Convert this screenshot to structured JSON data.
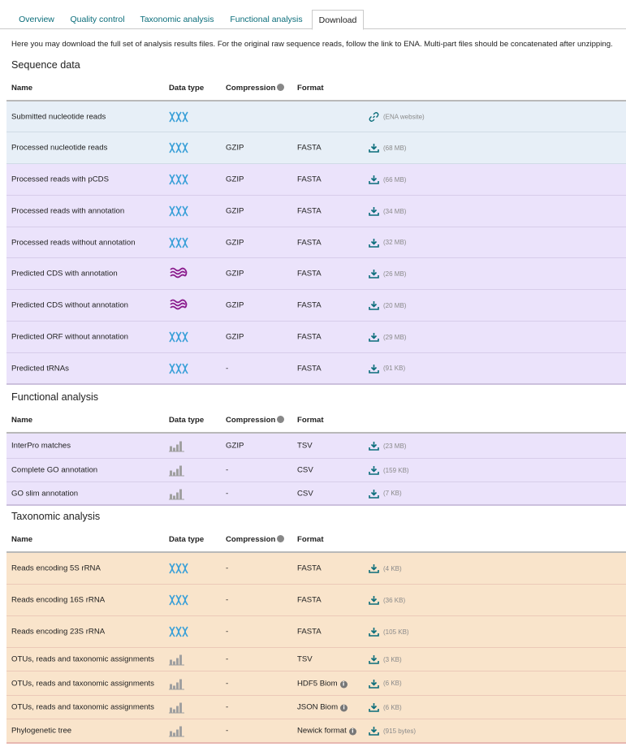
{
  "tabs": [
    {
      "label": "Overview"
    },
    {
      "label": "Quality control"
    },
    {
      "label": "Taxonomic analysis"
    },
    {
      "label": "Functional analysis"
    },
    {
      "label": "Download",
      "active": true
    }
  ],
  "intro": "Here you may download the full set of analysis results files. For the original raw sequence reads, follow the link to ENA. Multi-part files should be concatenated after unzipping.",
  "columns": {
    "name": "Name",
    "data_type": "Data type",
    "compression": "Compression",
    "format": "Format"
  },
  "sections": {
    "sequence": {
      "title": "Sequence data",
      "rows": [
        {
          "name": "Submitted nucleotide reads",
          "icon": "dna-icon",
          "compression": "",
          "format": "",
          "link": "link-icon",
          "size": "(ENA website)"
        },
        {
          "name": "Processed nucleotide reads",
          "icon": "dna-icon",
          "compression": "GZIP",
          "format": "FASTA",
          "link": "download-icon",
          "size": "(68 MB)"
        },
        {
          "name": "Processed reads with pCDS",
          "icon": "dna-icon",
          "compression": "GZIP",
          "format": "FASTA",
          "link": "download-icon",
          "size": "(66 MB)"
        },
        {
          "name": "Processed reads with annotation",
          "icon": "dna-icon",
          "compression": "GZIP",
          "format": "FASTA",
          "link": "download-icon",
          "size": "(34 MB)"
        },
        {
          "name": "Processed reads without annotation",
          "icon": "dna-icon",
          "compression": "GZIP",
          "format": "FASTA",
          "link": "download-icon",
          "size": "(32 MB)"
        },
        {
          "name": "Predicted CDS with annotation",
          "icon": "protein-icon",
          "compression": "GZIP",
          "format": "FASTA",
          "link": "download-icon",
          "size": "(26 MB)"
        },
        {
          "name": "Predicted CDS without annotation",
          "icon": "protein-icon",
          "compression": "GZIP",
          "format": "FASTA",
          "link": "download-icon",
          "size": "(20 MB)"
        },
        {
          "name": "Predicted ORF without annotation",
          "icon": "dna-icon",
          "compression": "GZIP",
          "format": "FASTA",
          "link": "download-icon",
          "size": "(29 MB)"
        },
        {
          "name": "Predicted tRNAs",
          "icon": "dna-icon",
          "compression": "-",
          "format": "FASTA",
          "link": "download-icon",
          "size": "(91 KB)"
        }
      ]
    },
    "functional": {
      "title": "Functional analysis",
      "rows": [
        {
          "name": "InterPro matches",
          "icon": "bar-chart-icon",
          "compression": "GZIP",
          "format": "TSV",
          "link": "download-icon",
          "size": "(23 MB)"
        },
        {
          "name": "Complete GO annotation",
          "icon": "bar-chart-icon",
          "compression": "-",
          "format": "CSV",
          "link": "download-icon",
          "size": "(159 KB)"
        },
        {
          "name": "GO slim annotation",
          "icon": "bar-chart-icon",
          "compression": "-",
          "format": "CSV",
          "link": "download-icon",
          "size": "(7 KB)"
        }
      ]
    },
    "taxonomic": {
      "title": "Taxonomic analysis",
      "rows": [
        {
          "name": "Reads encoding 5S rRNA",
          "icon": "dna-icon",
          "compression": "-",
          "format": "FASTA",
          "link": "download-icon",
          "size": "(4 KB)"
        },
        {
          "name": "Reads encoding 16S rRNA",
          "icon": "dna-icon",
          "compression": "-",
          "format": "FASTA",
          "link": "download-icon",
          "size": "(36 KB)"
        },
        {
          "name": "Reads encoding 23S rRNA",
          "icon": "dna-icon",
          "compression": "-",
          "format": "FASTA",
          "link": "download-icon",
          "size": "(105 KB)"
        },
        {
          "name": "OTUs, reads and taxonomic assignments",
          "icon": "bar-chart-icon",
          "compression": "-",
          "format": "TSV",
          "link": "download-icon",
          "size": "(3 KB)"
        },
        {
          "name": "OTUs, reads and taxonomic assignments",
          "icon": "bar-chart-icon",
          "compression": "-",
          "format": "HDF5 Biom",
          "format_info": true,
          "link": "download-icon",
          "size": "(6 KB)"
        },
        {
          "name": "OTUs, reads and taxonomic assignments",
          "icon": "bar-chart-icon",
          "compression": "-",
          "format": "JSON Biom",
          "format_info": true,
          "link": "download-icon",
          "size": "(6 KB)"
        },
        {
          "name": "Phylogenetic tree",
          "icon": "bar-chart-icon",
          "compression": "-",
          "format": "Newick format",
          "format_info": true,
          "link": "download-icon",
          "size": "(915 bytes)"
        }
      ]
    }
  },
  "colors": {
    "accent": "#0a6d7a",
    "dna_icon": "#3aa0d8",
    "protein_icon": "#8a1a8c",
    "chart_icon": "#a0a0a0",
    "row_blue": "#e7eff7",
    "row_purple": "#ebe3fb",
    "row_orange": "#f9e4cb"
  }
}
